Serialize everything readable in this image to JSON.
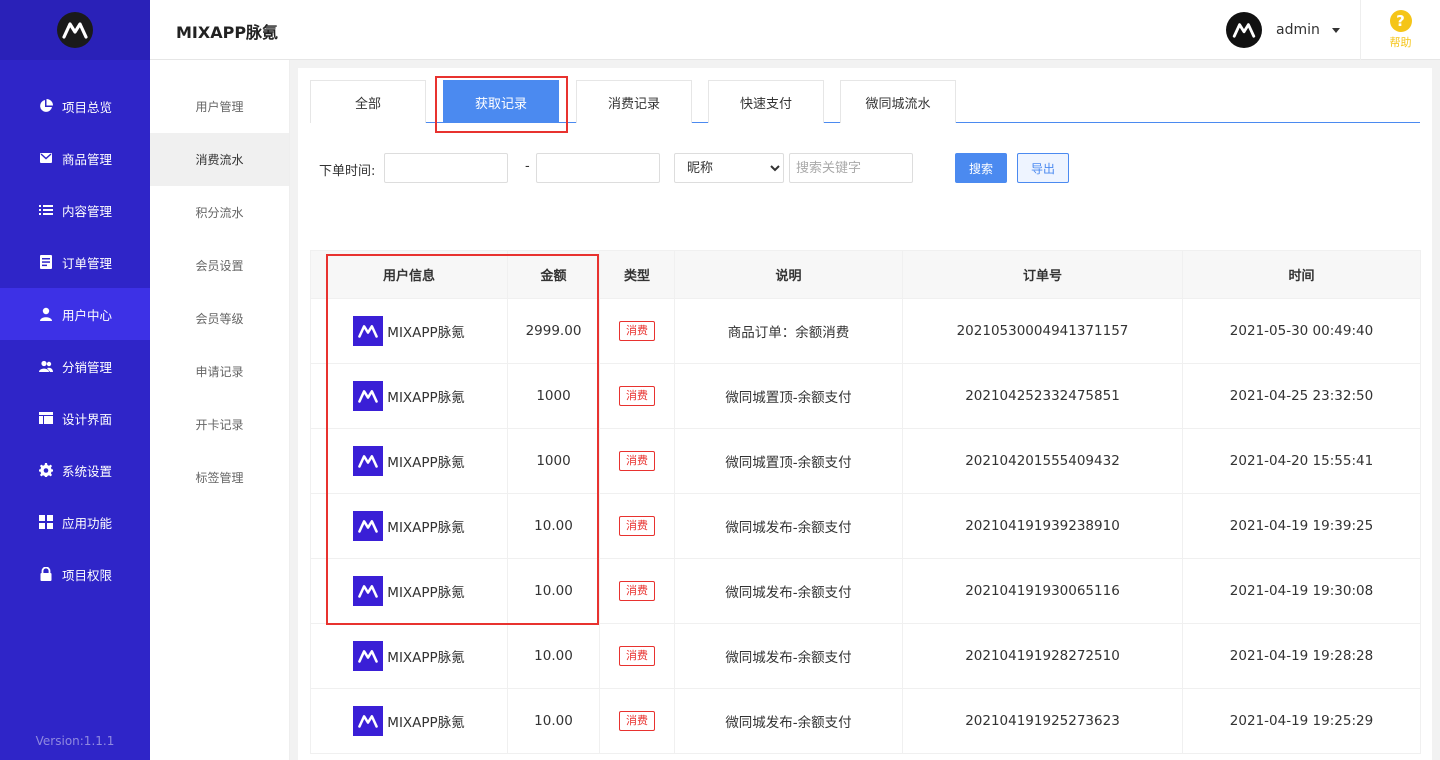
{
  "app": {
    "title": "MIXAPP脉氪"
  },
  "header": {
    "user_name": "admin",
    "help_label": "帮助"
  },
  "sidebar": {
    "items": [
      {
        "label": "项目总览",
        "icon": "pie-chart-icon"
      },
      {
        "label": "商品管理",
        "icon": "envelope-icon"
      },
      {
        "label": "内容管理",
        "icon": "list-icon"
      },
      {
        "label": "订单管理",
        "icon": "document-icon"
      },
      {
        "label": "用户中心",
        "icon": "user-icon",
        "active": true
      },
      {
        "label": "分销管理",
        "icon": "users-icon"
      },
      {
        "label": "设计界面",
        "icon": "layout-icon"
      },
      {
        "label": "系统设置",
        "icon": "gear-icon"
      },
      {
        "label": "应用功能",
        "icon": "grid-icon"
      },
      {
        "label": "项目权限",
        "icon": "lock-icon"
      }
    ],
    "version": "Version:1.1.1"
  },
  "subnav": {
    "items": [
      "用户管理",
      "消费流水",
      "积分流水",
      "会员设置",
      "会员等级",
      "申请记录",
      "开卡记录",
      "标签管理"
    ],
    "active_index": 1
  },
  "tabs": [
    "全部",
    "获取记录",
    "消费记录",
    "快速支付",
    "微同城流水"
  ],
  "active_tab": 1,
  "filters": {
    "date_label": "下单时间:",
    "range_separator": "-",
    "date_start": "",
    "date_end": "",
    "field_select": "昵称",
    "search_placeholder": "搜索关键字",
    "search_button": "搜索",
    "export_button": "导出"
  },
  "table": {
    "columns": [
      "用户信息",
      "金额",
      "类型",
      "说明",
      "订单号",
      "时间"
    ],
    "rows": [
      {
        "user": "MIXAPP脉氪",
        "amount": "2999.00",
        "type": "消费",
        "desc": "商品订单：余额消费",
        "order": "20210530004941371157",
        "time": "2021-05-30 00:49:40"
      },
      {
        "user": "MIXAPP脉氪",
        "amount": "1000",
        "type": "消费",
        "desc": "微同城置顶-余额支付",
        "order": "202104252332475851",
        "time": "2021-04-25 23:32:50"
      },
      {
        "user": "MIXAPP脉氪",
        "amount": "1000",
        "type": "消费",
        "desc": "微同城置顶-余额支付",
        "order": "202104201555409432",
        "time": "2021-04-20 15:55:41"
      },
      {
        "user": "MIXAPP脉氪",
        "amount": "10.00",
        "type": "消费",
        "desc": "微同城发布-余额支付",
        "order": "202104191939238910",
        "time": "2021-04-19 19:39:25"
      },
      {
        "user": "MIXAPP脉氪",
        "amount": "10.00",
        "type": "消费",
        "desc": "微同城发布-余额支付",
        "order": "202104191930065116",
        "time": "2021-04-19 19:30:08"
      },
      {
        "user": "MIXAPP脉氪",
        "amount": "10.00",
        "type": "消费",
        "desc": "微同城发布-余额支付",
        "order": "202104191928272510",
        "time": "2021-04-19 19:28:28"
      },
      {
        "user": "MIXAPP脉氪",
        "amount": "10.00",
        "type": "消费",
        "desc": "微同城发布-余额支付",
        "order": "202104191925273623",
        "time": "2021-04-19 19:25:29"
      }
    ]
  },
  "colors": {
    "sidebar": "#2f25c8",
    "primary": "#4b8af0",
    "highlight": "#e8322f",
    "help": "#f5c518"
  }
}
